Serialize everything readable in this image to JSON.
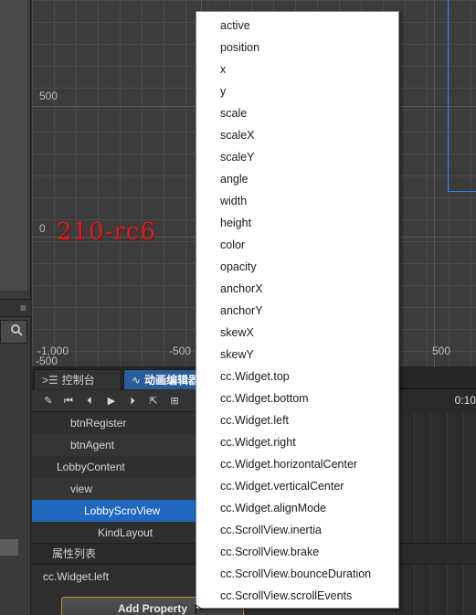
{
  "scene": {
    "y_labels": [
      "500",
      "0",
      "-500"
    ],
    "x_labels": [
      "-1,000",
      "-500",
      "500"
    ],
    "watermark": "210-rc6",
    "accent_color": "#2f84f5"
  },
  "tabs": [
    {
      "label": "控制台",
      "icon": "console-icon"
    },
    {
      "label": "动画编辑器",
      "icon": "animation-icon"
    }
  ],
  "anim_toolbar": {
    "icons": [
      "edit-icon",
      "first-frame-icon",
      "prev-frame-icon",
      "play-icon",
      "next-frame-icon",
      "export-icon",
      "add-icon"
    ],
    "time_label": "0:10"
  },
  "node_tree": [
    {
      "label": "btnRegister",
      "indent": 2
    },
    {
      "label": "btnAgent",
      "indent": 2
    },
    {
      "label": "LobbyContent",
      "indent": 1
    },
    {
      "label": "view",
      "indent": 2
    },
    {
      "label": "LobbyScroView",
      "indent": 3,
      "selected": true
    },
    {
      "label": "KindLayout",
      "indent": 4
    }
  ],
  "properties": {
    "header": "属性列表",
    "items": [
      "cc.Widget.left"
    ],
    "add_button": "Add Property"
  },
  "property_menu": {
    "options": [
      "active",
      "position",
      "x",
      "y",
      "scale",
      "scaleX",
      "scaleY",
      "angle",
      "width",
      "height",
      "color",
      "opacity",
      "anchorX",
      "anchorY",
      "skewX",
      "skewY",
      "cc.Widget.top",
      "cc.Widget.bottom",
      "cc.Widget.left",
      "cc.Widget.right",
      "cc.Widget.horizontalCenter",
      "cc.Widget.verticalCenter",
      "cc.Widget.alignMode",
      "cc.ScrollView.inertia",
      "cc.ScrollView.brake",
      "cc.ScrollView.bounceDuration",
      "cc.ScrollView.scrollEvents"
    ]
  }
}
